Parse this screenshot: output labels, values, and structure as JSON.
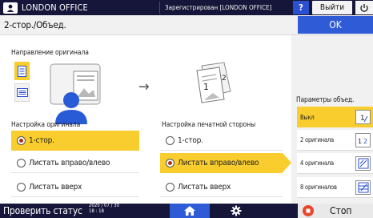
{
  "topbar": {
    "title": "LONDON OFFICE",
    "login_status": "Зарегистрирован [LONDON OFFICE]",
    "help_label": "?",
    "logout_label": "Выйти"
  },
  "header": {
    "title": "2-стор./Объед.",
    "ok_label": "OK"
  },
  "orientation": {
    "label": "Направление оригинала",
    "selected": "portrait"
  },
  "original_setting": {
    "label": "Настройка оригинала",
    "options": [
      "1-стор.",
      "Листать вправо/влево",
      "Листать вверх"
    ],
    "selected_index": 0
  },
  "print_side": {
    "label": "Настройка печатной стороны",
    "options": [
      "1-стор.",
      "Листать вправо/влево",
      "Листать вверх"
    ],
    "selected_index": 1
  },
  "combine": {
    "label": "Параметры объед.",
    "options": [
      "Выкл",
      "2 оригинала",
      "4 оригинала",
      "8 оригиналов"
    ],
    "selected_index": 0
  },
  "bottombar": {
    "status_label": "Проверить статус",
    "date": "2020 / 07 / 30",
    "time": "18 : 18",
    "stop_label": "Стоп"
  },
  "colors": {
    "accent_yellow": "#f9cd2e",
    "accent_blue": "#2f5bd7",
    "bar_navy": "#16163a",
    "stop_red": "#e8452c"
  }
}
